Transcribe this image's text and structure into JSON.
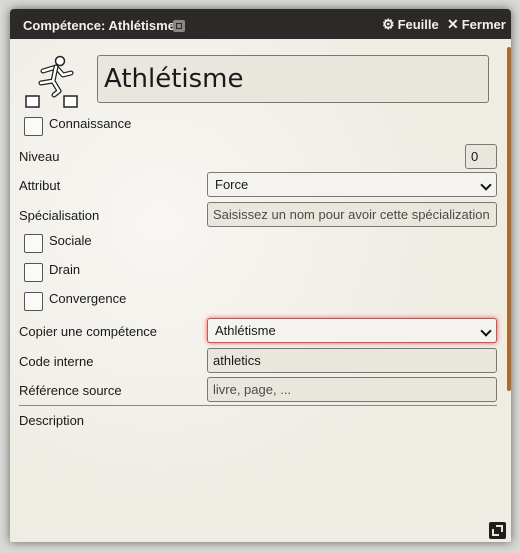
{
  "window": {
    "title": "Compétence: Athlétisme",
    "sheet_label": "Feuille",
    "close_label": "Fermer"
  },
  "skill": {
    "name": "Athlétisme",
    "knowledge_label": "Connaissance",
    "level_label": "Niveau",
    "level_value": "0",
    "attribute_label": "Attribut",
    "attribute_value": "Force",
    "specialization_label": "Spécialisation",
    "specialization_placeholder": "Saisissez un nom pour avoir cette spécialization",
    "social_label": "Sociale",
    "drain_label": "Drain",
    "convergence_label": "Convergence",
    "copy_label": "Copier une compétence",
    "copy_value": "Athlétisme",
    "internal_code_label": "Code interne",
    "internal_code_value": "athletics",
    "source_label": "Référence source",
    "source_placeholder": "livre, page, ...",
    "description_label": "Description"
  },
  "icons": {
    "sheet": "gear-icon",
    "close": "close-icon",
    "skill": "athlete-icon",
    "resize": "resize-icon"
  },
  "colors": {
    "titlebar": "#2b2a28",
    "accent": "#b06a2c",
    "focus": "#d45050"
  }
}
